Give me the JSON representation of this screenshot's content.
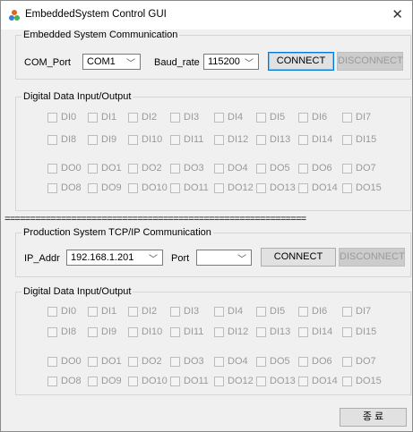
{
  "window": {
    "title": "EmbeddedSystem Control GUI",
    "close_glyph": "✕"
  },
  "embedded": {
    "legend": "Embedded System Communication",
    "com_port_label": "COM_Port",
    "com_port_value": "COM1",
    "baud_label": "Baud_rate",
    "baud_value": "115200",
    "connect_label": "CONNECT",
    "disconnect_label": "DISCONNECT"
  },
  "io1": {
    "legend": "Digital Data Input/Output",
    "di_row1": [
      "DI0",
      "DI1",
      "DI2",
      "DI3",
      "DI4",
      "DI5",
      "DI6",
      "DI7"
    ],
    "di_row2": [
      "DI8",
      "DI9",
      "DI10",
      "DI11",
      "DI12",
      "DI13",
      "DI14",
      "DI15"
    ],
    "do_row1": [
      "DO0",
      "DO1",
      "DO2",
      "DO3",
      "DO4",
      "DO5",
      "DO6",
      "DO7"
    ],
    "do_row2": [
      "DO8",
      "DO9",
      "DO10",
      "DO11",
      "DO12",
      "DO13",
      "DO14",
      "DO15"
    ]
  },
  "separator": "===========================================================",
  "production": {
    "legend": "Production System TCP/IP Communication",
    "ip_label": "IP_Addr",
    "ip_value": "192.168.1.201",
    "port_label": "Port",
    "port_value": "",
    "connect_label": "CONNECT",
    "disconnect_label": "DISCONNECT"
  },
  "io2": {
    "legend": "Digital Data Input/Output",
    "di_row1": [
      "DI0",
      "DI1",
      "DI2",
      "DI3",
      "DI4",
      "DI5",
      "DI6",
      "DI7"
    ],
    "di_row2": [
      "DI8",
      "DI9",
      "DI10",
      "DI11",
      "DI12",
      "DI13",
      "DI14",
      "DI15"
    ],
    "do_row1": [
      "DO0",
      "DO1",
      "DO2",
      "DO3",
      "DO4",
      "DO5",
      "DO6",
      "DO7"
    ],
    "do_row2": [
      "DO8",
      "DO9",
      "DO10",
      "DO11",
      "DO12",
      "DO13",
      "DO14",
      "DO15"
    ]
  },
  "footer": {
    "exit_label": "종 료"
  },
  "colors": {
    "accent": "#0078d7",
    "disabled_text": "#9a9a9a",
    "app_icon": "#e2661b"
  },
  "icons": {
    "app": "app-colorful-icon",
    "dropdown": "chevron-down-icon"
  }
}
